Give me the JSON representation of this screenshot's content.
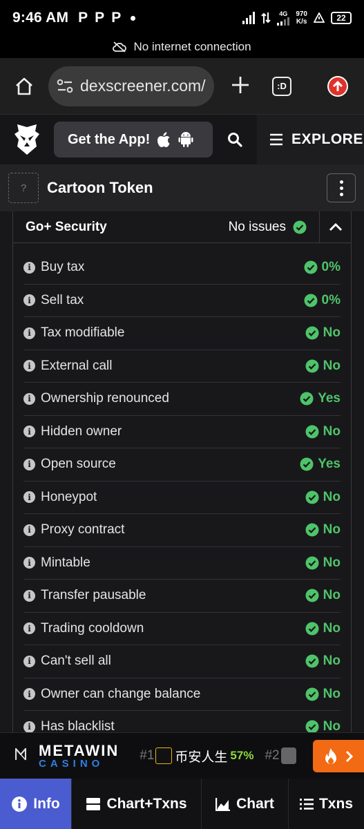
{
  "status_bar": {
    "time": "9:46 AM",
    "notification_letters": [
      "P",
      "P",
      "P"
    ],
    "net_speed": "970",
    "net_unit": "K/s",
    "network_type": "4G",
    "battery": "22"
  },
  "connectivity_banner": {
    "text": "No internet connection"
  },
  "browser": {
    "url": "dexscreener.com/",
    "tabs_label": ":D"
  },
  "site_header": {
    "get_app_label": "Get the App!",
    "explore_label": "EXPLORE"
  },
  "token": {
    "name": "Cartoon Token",
    "placeholder_glyph": "?"
  },
  "security": {
    "title": "Go+ Security",
    "status": "No issues",
    "status_color": "#4ec46a",
    "items": [
      {
        "label": "Buy tax",
        "value": "0%"
      },
      {
        "label": "Sell tax",
        "value": "0%"
      },
      {
        "label": "Tax modifiable",
        "value": "No"
      },
      {
        "label": "External call",
        "value": "No"
      },
      {
        "label": "Ownership renounced",
        "value": "Yes"
      },
      {
        "label": "Hidden owner",
        "value": "No"
      },
      {
        "label": "Open source",
        "value": "Yes"
      },
      {
        "label": "Honeypot",
        "value": "No"
      },
      {
        "label": "Proxy contract",
        "value": "No"
      },
      {
        "label": "Mintable",
        "value": "No"
      },
      {
        "label": "Transfer pausable",
        "value": "No"
      },
      {
        "label": "Trading cooldown",
        "value": "No"
      },
      {
        "label": "Can't sell all",
        "value": "No"
      },
      {
        "label": "Owner can change balance",
        "value": "No"
      },
      {
        "label": "Has blacklist",
        "value": "No"
      }
    ]
  },
  "ad": {
    "brand_top": "METAWIN",
    "brand_bottom": "CASINO",
    "trending_1_rank": "#1",
    "trending_1_name": "币安人生",
    "trending_1_change": "57%",
    "trending_2_rank": "#2"
  },
  "bottom_tabs": [
    {
      "label": "Info",
      "icon": "info-icon",
      "active": true
    },
    {
      "label": "Chart+Txns",
      "icon": "chart-txns-icon",
      "active": false
    },
    {
      "label": "Chart",
      "icon": "chart-icon",
      "active": false
    },
    {
      "label": "Txns",
      "icon": "list-icon",
      "active": false
    }
  ]
}
